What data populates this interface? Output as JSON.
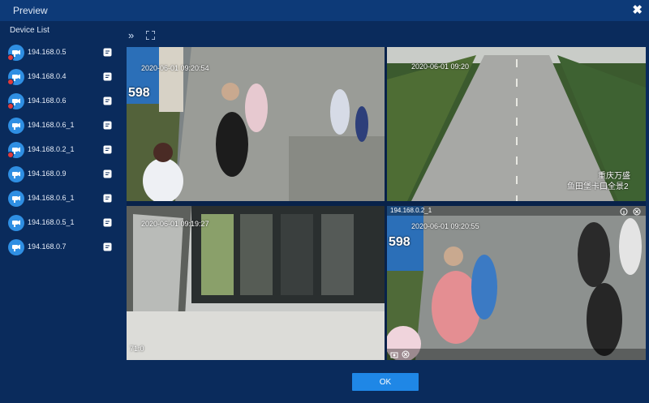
{
  "window": {
    "title": "Preview"
  },
  "sidebar": {
    "header": "Device List",
    "devices": [
      {
        "label": "194.168.0.5",
        "status": "offline"
      },
      {
        "label": "194.168.0.4",
        "status": "offline"
      },
      {
        "label": "194.168.0.6",
        "status": "offline"
      },
      {
        "label": "194.168.0.6_1",
        "status": "online"
      },
      {
        "label": "194.168.0.2_1",
        "status": "offline"
      },
      {
        "label": "194.168.0.9",
        "status": "online"
      },
      {
        "label": "194.168.0.6_1",
        "status": "online"
      },
      {
        "label": "194.168.0.5_1",
        "status": "online"
      },
      {
        "label": "194.168.0.7",
        "status": "online"
      }
    ]
  },
  "toolbar": {
    "expand_icon": "double-chevron-right-icon",
    "fullscreen_icon": "fullscreen-icon"
  },
  "feeds": {
    "cam1": {
      "timestamp": "2020-06-01  09:20:54",
      "sign": "598"
    },
    "cam2": {
      "timestamp": "2020-06-01  09:20",
      "caption_line1": "重庆万盛",
      "caption_line2": "鱼田堡卡口全景2"
    },
    "cam3": {
      "timestamp": "2020-06-01  09:19:27",
      "corner": "71:0"
    },
    "cam4": {
      "title": "194.168.0.2_1",
      "timestamp": "2020-06-01  09:20:55",
      "sign": "598"
    }
  },
  "footer": {
    "ok_label": "OK"
  },
  "colors": {
    "background": "#0a2b5c",
    "titlebar": "#0d3a78",
    "accent": "#1f87e6",
    "offline": "#e23b3b"
  }
}
